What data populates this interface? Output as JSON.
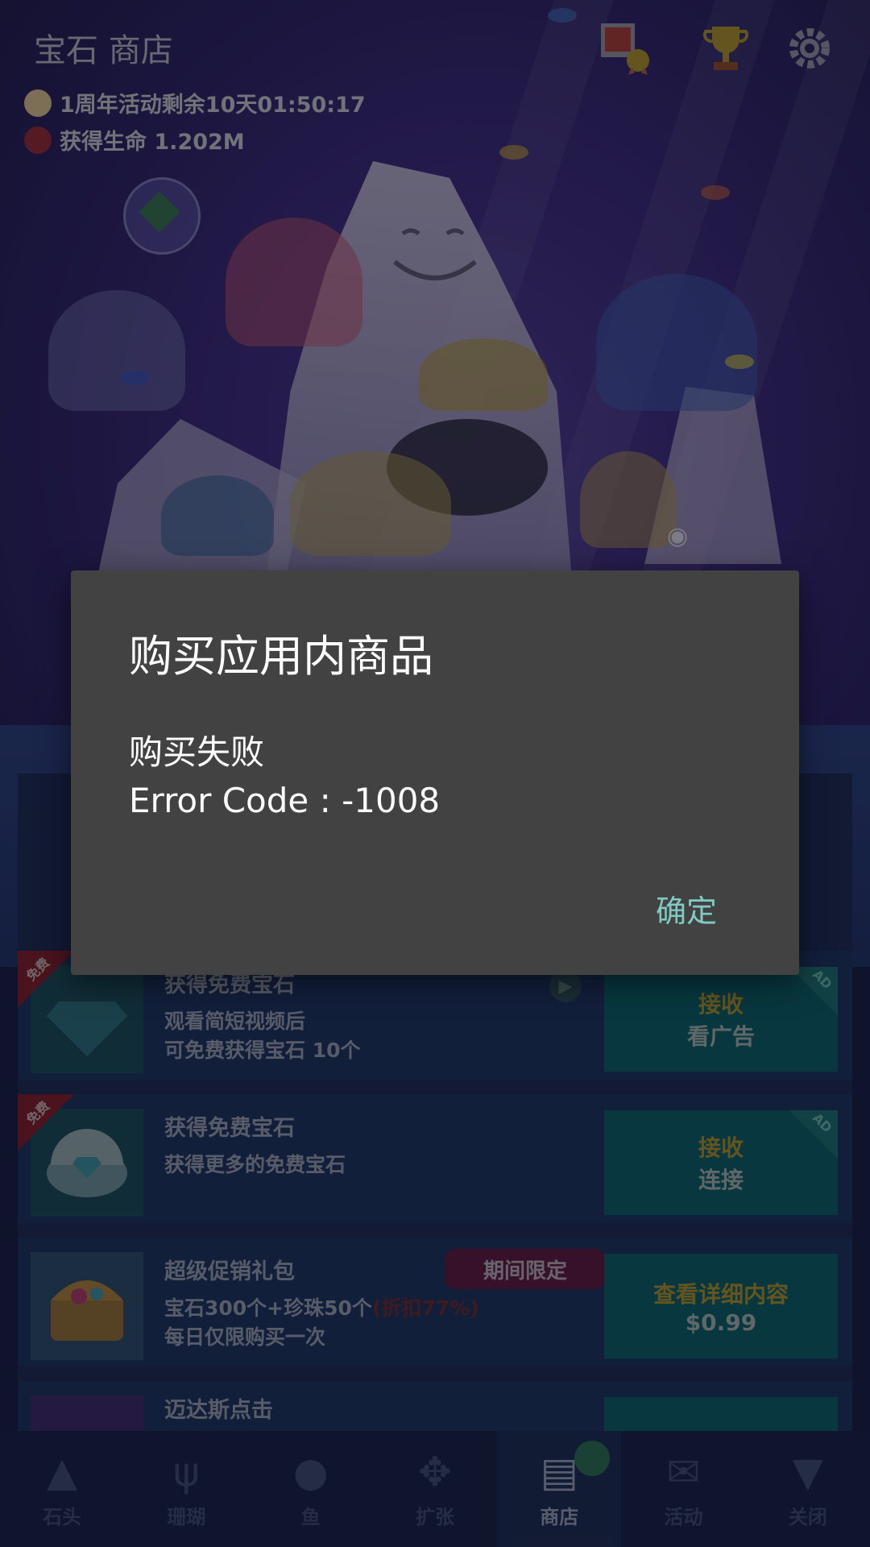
{
  "app": {
    "title": "宝石 商店",
    "event_timer": "1周年活动剩余10天01:50:17",
    "life_gain": "获得生命 1.202M"
  },
  "top_icons": [
    "photo-award-icon",
    "trophy-icon",
    "gear-icon"
  ],
  "shop": {
    "items": [
      {
        "badge": "免费",
        "title": "获得免费宝石",
        "desc_line1": "观看简短视频后",
        "desc_line2": "可免费获得宝石 10个",
        "btn_line1": "接收",
        "btn_line2": "看广告",
        "ad_tag": "AD"
      },
      {
        "badge": "免费",
        "title": "获得免费宝石",
        "desc_line1": "获得更多的免费宝石",
        "btn_line1": "接收",
        "btn_line2": "连接",
        "ad_tag": "AD"
      },
      {
        "title": "超级促销礼包",
        "limited_label": "期间限定",
        "desc_line1": "宝石300个+珍珠50个",
        "desc_discount": "(折扣77%)",
        "desc_line2": "每日仅限购买一次",
        "btn_line1": "查看详细内容",
        "btn_line2": "$0.99"
      },
      {
        "title": "迈达斯点击"
      }
    ]
  },
  "nav": {
    "items": [
      {
        "label": "石头",
        "icon": "rock-icon"
      },
      {
        "label": "珊瑚",
        "icon": "coral-icon"
      },
      {
        "label": "鱼",
        "icon": "fish-icon"
      },
      {
        "label": "扩张",
        "icon": "expand-icon"
      },
      {
        "label": "商店",
        "icon": "cart-icon",
        "active": true
      },
      {
        "label": "活动",
        "icon": "event-icon"
      },
      {
        "label": "关闭",
        "icon": "close-down-icon"
      }
    ]
  },
  "dialog": {
    "title": "购买应用内商品",
    "message_line1": "购买失败",
    "message_line2": "Error Code : -1008",
    "ok_label": "确定"
  },
  "colors": {
    "dialog_bg": "#424242",
    "dialog_accent": "#80cbc4",
    "overlay": "rgba(0,0,0,0.38)"
  }
}
